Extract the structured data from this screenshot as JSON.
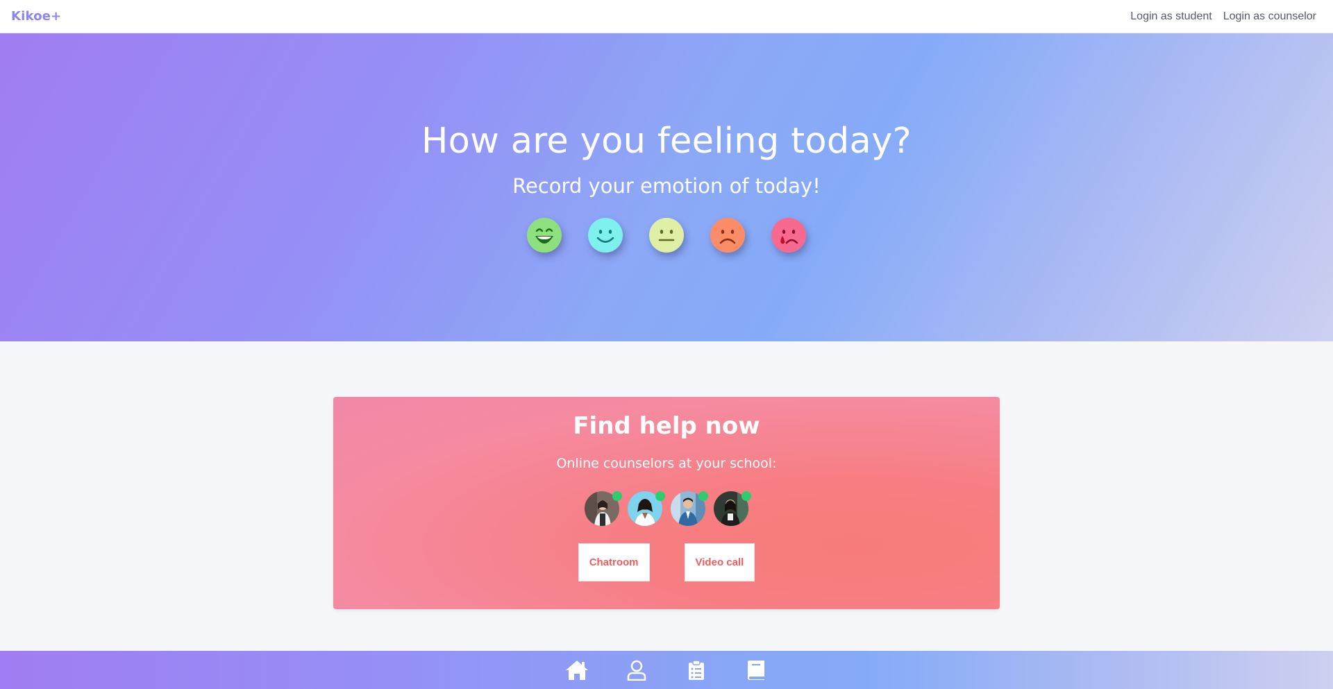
{
  "brand": "Kikoe+",
  "nav": {
    "login_student": "Login as student",
    "login_counselor": "Login as counselor"
  },
  "hero": {
    "title": "How are you feeling today?",
    "subtitle": "Record your emotion of today!",
    "emotions": [
      {
        "name": "very-happy",
        "color": "#8ee07f"
      },
      {
        "name": "happy",
        "color": "#7ff0ee"
      },
      {
        "name": "neutral",
        "color": "#dff0a6"
      },
      {
        "name": "sad",
        "color": "#fb8c68"
      },
      {
        "name": "crying",
        "color": "#f7698f"
      }
    ]
  },
  "help": {
    "title": "Find help now",
    "subtitle": "Online counselors at your school:",
    "counselors_online": 4,
    "chatroom_label": "Chatroom",
    "videocall_label": "Video call"
  },
  "bottom_nav": {
    "items": [
      "home-icon",
      "user-icon",
      "clipboard-icon",
      "book-icon"
    ]
  },
  "colors": {
    "brand": "#8b86f0",
    "online": "#2ecc71",
    "button_text": "#ee5d5d"
  }
}
